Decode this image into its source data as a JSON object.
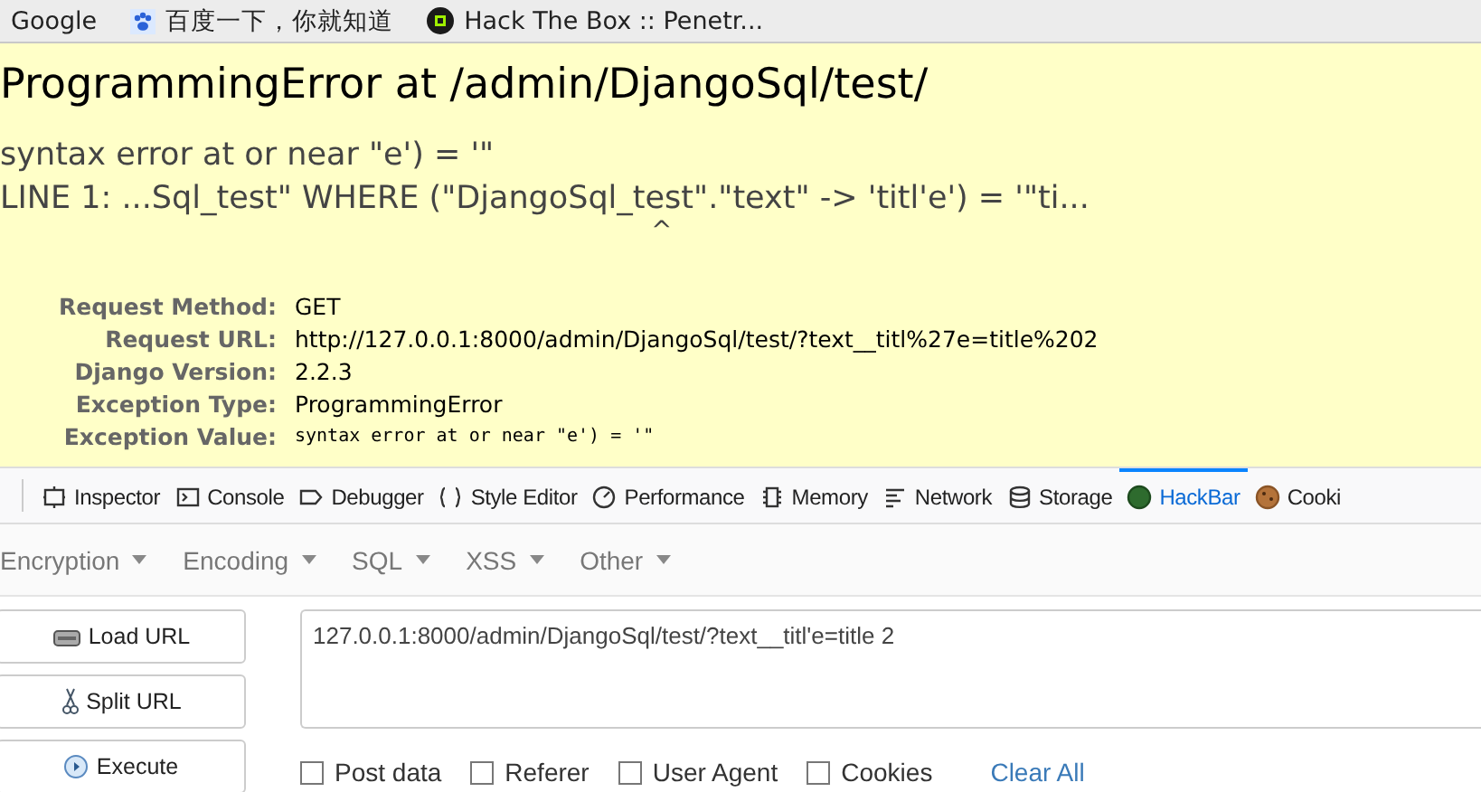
{
  "bookmarks": [
    {
      "label": "Google"
    },
    {
      "label": "百度一下，你就知道"
    },
    {
      "label": "Hack The Box :: Penetr..."
    }
  ],
  "error": {
    "title": "ProgrammingError at /admin/DjangoSql/test/",
    "message": "syntax error at or near \"e') = '\"",
    "line": "LINE 1: ...Sql_test\" WHERE (\"DjangoSql_test\".\"text\" -> 'titl'e') = '\"ti...",
    "caret": "^"
  },
  "summary": [
    {
      "label": "Request Method:",
      "value": "GET",
      "kind": "text"
    },
    {
      "label": "Request URL:",
      "value": "http://127.0.0.1:8000/admin/DjangoSql/test/?text__titl%27e=title%202",
      "kind": "text"
    },
    {
      "label": "Django Version:",
      "value": "2.2.3",
      "kind": "text"
    },
    {
      "label": "Exception Type:",
      "value": "ProgrammingError",
      "kind": "text"
    },
    {
      "label": "Exception Value:",
      "value": "syntax error at or near \"e') = '\"",
      "kind": "code"
    }
  ],
  "devtools_tabs": [
    {
      "label": "Inspector",
      "selected": false
    },
    {
      "label": "Console",
      "selected": false
    },
    {
      "label": "Debugger",
      "selected": false
    },
    {
      "label": "Style Editor",
      "selected": false
    },
    {
      "label": "Performance",
      "selected": false
    },
    {
      "label": "Memory",
      "selected": false
    },
    {
      "label": "Network",
      "selected": false
    },
    {
      "label": "Storage",
      "selected": false
    },
    {
      "label": "HackBar",
      "selected": true
    },
    {
      "label": "Cooki",
      "selected": false
    }
  ],
  "hackbar_menu": [
    "Encryption",
    "Encoding",
    "SQL",
    "XSS",
    "Other"
  ],
  "actions": [
    {
      "label": "Load URL"
    },
    {
      "label": "Split URL"
    },
    {
      "label": "Execute"
    }
  ],
  "url_field": {
    "value": "127.0.0.1:8000/admin/DjangoSql/test/?text__titl'e=title 2"
  },
  "options": [
    {
      "label": "Post data",
      "checked": false
    },
    {
      "label": "Referer",
      "checked": false
    },
    {
      "label": "User Agent",
      "checked": false
    },
    {
      "label": "Cookies",
      "checked": false
    }
  ],
  "clear_link": "Clear All"
}
